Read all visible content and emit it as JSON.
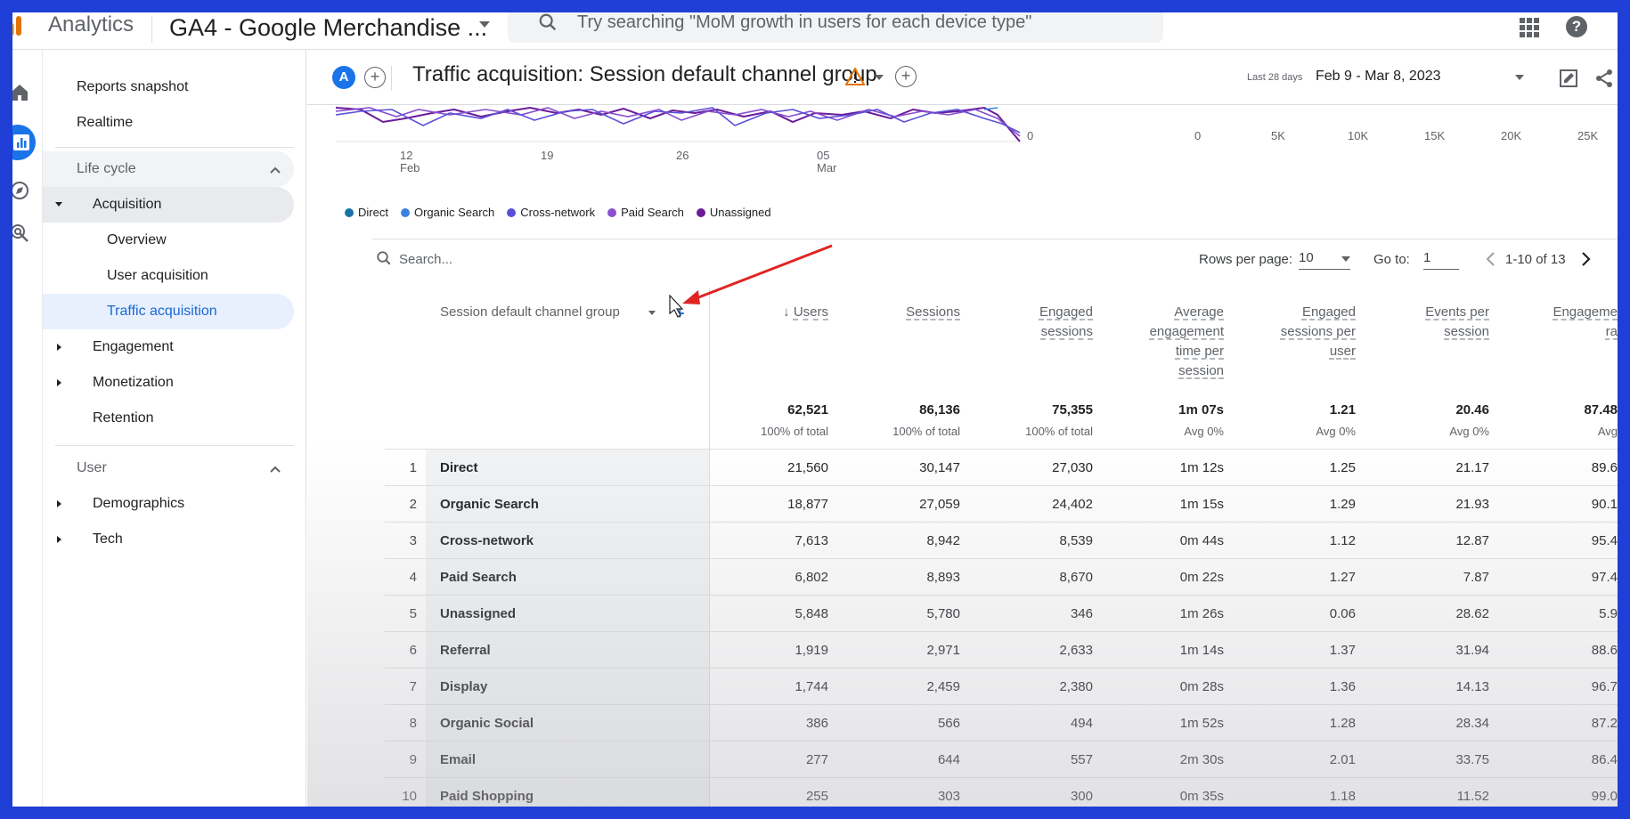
{
  "topbar": {
    "app_name": "Analytics",
    "property_name": "GA4 - Google Merchandise ...",
    "search_placeholder": "Try searching \"MoM growth in users for each device type\""
  },
  "sidebar": {
    "reports_snapshot": "Reports snapshot",
    "realtime": "Realtime",
    "lifecycle": "Life cycle",
    "acquisition": "Acquisition",
    "overview": "Overview",
    "user_acquisition": "User acquisition",
    "traffic_acquisition": "Traffic acquisition",
    "engagement": "Engagement",
    "monetization": "Monetization",
    "retention": "Retention",
    "user": "User",
    "demographics": "Demographics",
    "tech": "Tech"
  },
  "header": {
    "avatar": "A",
    "title": "Traffic acquisition: Session default channel group",
    "date_label": "Last 28 days",
    "date_range": "Feb 9 - Mar 8, 2023"
  },
  "chart": {
    "x_ticks": [
      {
        "day": "12",
        "month": "Feb"
      },
      {
        "day": "19",
        "month": ""
      },
      {
        "day": "26",
        "month": ""
      },
      {
        "day": "05",
        "month": "Mar"
      }
    ],
    "y_zero": "0",
    "bar_ticks": [
      "0",
      "5K",
      "10K",
      "15K",
      "20K",
      "25K"
    ],
    "legend": [
      {
        "name": "Direct",
        "color": "#1a73a8"
      },
      {
        "name": "Organic Search",
        "color": "#3b82e0"
      },
      {
        "name": "Cross-network",
        "color": "#5b4fd8"
      },
      {
        "name": "Paid Search",
        "color": "#8a4fd0"
      },
      {
        "name": "Unassigned",
        "color": "#6a1b9a"
      }
    ]
  },
  "toolbar": {
    "search_placeholder": "Search...",
    "rows_per_page_label": "Rows per page:",
    "rows_per_page_value": "10",
    "goto_label": "Go to:",
    "goto_value": "1",
    "pagination": "1-10 of 13"
  },
  "table": {
    "dimension_header": "Session default channel group",
    "columns": [
      {
        "lines": [
          "Users"
        ],
        "total": "62,521",
        "sub": "100% of total",
        "sorted": true
      },
      {
        "lines": [
          "Sessions"
        ],
        "total": "86,136",
        "sub": "100% of total"
      },
      {
        "lines": [
          "Engaged",
          "sessions"
        ],
        "total": "75,355",
        "sub": "100% of total"
      },
      {
        "lines": [
          "Average",
          "engagement",
          "time per",
          "session"
        ],
        "total": "1m 07s",
        "sub": "Avg 0%"
      },
      {
        "lines": [
          "Engaged",
          "sessions per",
          "user"
        ],
        "total": "1.21",
        "sub": "Avg 0%"
      },
      {
        "lines": [
          "Events per",
          "session"
        ],
        "total": "20.46",
        "sub": "Avg 0%"
      },
      {
        "lines": [
          "Engageme",
          "ra"
        ],
        "total": "87.48",
        "sub": "Avg"
      }
    ],
    "rows": [
      {
        "idx": "1",
        "name": "Direct",
        "vals": [
          "21,560",
          "30,147",
          "27,030",
          "1m 12s",
          "1.25",
          "21.17",
          "89.6"
        ]
      },
      {
        "idx": "2",
        "name": "Organic Search",
        "vals": [
          "18,877",
          "27,059",
          "24,402",
          "1m 15s",
          "1.29",
          "21.93",
          "90.1"
        ]
      },
      {
        "idx": "3",
        "name": "Cross-network",
        "vals": [
          "7,613",
          "8,942",
          "8,539",
          "0m 44s",
          "1.12",
          "12.87",
          "95.4"
        ]
      },
      {
        "idx": "4",
        "name": "Paid Search",
        "vals": [
          "6,802",
          "8,893",
          "8,670",
          "0m 22s",
          "1.27",
          "7.87",
          "97.4"
        ]
      },
      {
        "idx": "5",
        "name": "Unassigned",
        "vals": [
          "5,848",
          "5,780",
          "346",
          "1m 26s",
          "0.06",
          "28.62",
          "5.9"
        ]
      },
      {
        "idx": "6",
        "name": "Referral",
        "vals": [
          "1,919",
          "2,971",
          "2,633",
          "1m 14s",
          "1.37",
          "31.94",
          "88.6"
        ]
      },
      {
        "idx": "7",
        "name": "Display",
        "vals": [
          "1,744",
          "2,459",
          "2,380",
          "0m 28s",
          "1.36",
          "14.13",
          "96.7"
        ]
      },
      {
        "idx": "8",
        "name": "Organic Social",
        "vals": [
          "386",
          "566",
          "494",
          "1m 52s",
          "1.28",
          "28.34",
          "87.2"
        ]
      },
      {
        "idx": "9",
        "name": "Email",
        "vals": [
          "277",
          "644",
          "557",
          "2m 30s",
          "2.01",
          "33.75",
          "86.4"
        ]
      },
      {
        "idx": "10",
        "name": "Paid Shopping",
        "vals": [
          "255",
          "303",
          "300",
          "0m 35s",
          "1.18",
          "11.52",
          "99.0"
        ]
      }
    ]
  }
}
